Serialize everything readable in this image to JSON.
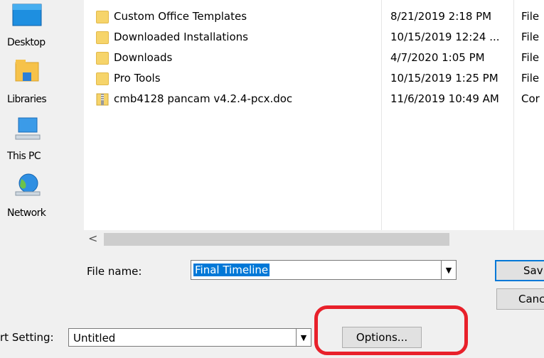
{
  "places": [
    {
      "label": "Desktop",
      "icon": "desktop-icon"
    },
    {
      "label": "Libraries",
      "icon": "libraries-icon"
    },
    {
      "label": "This PC",
      "icon": "computer-icon"
    },
    {
      "label": "Network",
      "icon": "network-icon"
    }
  ],
  "files": [
    {
      "name": "Custom Office Templates",
      "date": "8/21/2019 2:18 PM",
      "type": "File",
      "icon": "folder-icon"
    },
    {
      "name": "Downloaded Installations",
      "date": "10/15/2019 12:24 ...",
      "type": "File",
      "icon": "folder-icon"
    },
    {
      "name": "Downloads",
      "date": "4/7/2020 1:05 PM",
      "type": "File",
      "icon": "folder-icon"
    },
    {
      "name": "Pro Tools",
      "date": "10/15/2019 1:25 PM",
      "type": "File",
      "icon": "folder-icon"
    },
    {
      "name": "cmb4128 pancam v4.2.4-pcx.doc",
      "date": "11/6/2019 10:49 AM",
      "type": "Cor",
      "icon": "compressed-file-icon"
    }
  ],
  "scrollbar": {
    "left_arrow": "<"
  },
  "filename": {
    "label": "File name:",
    "value": "Final Timeline",
    "dropdown_glyph": "▼"
  },
  "buttons": {
    "save": "Sav",
    "cancel": "Canc",
    "options": "Options..."
  },
  "setting": {
    "label": "rt Setting:",
    "value": "Untitled",
    "dropdown_glyph": "▼"
  },
  "colors": {
    "selection": "#0078d7",
    "highlight_circle": "#e8202a",
    "folder": "#f6d46a"
  }
}
